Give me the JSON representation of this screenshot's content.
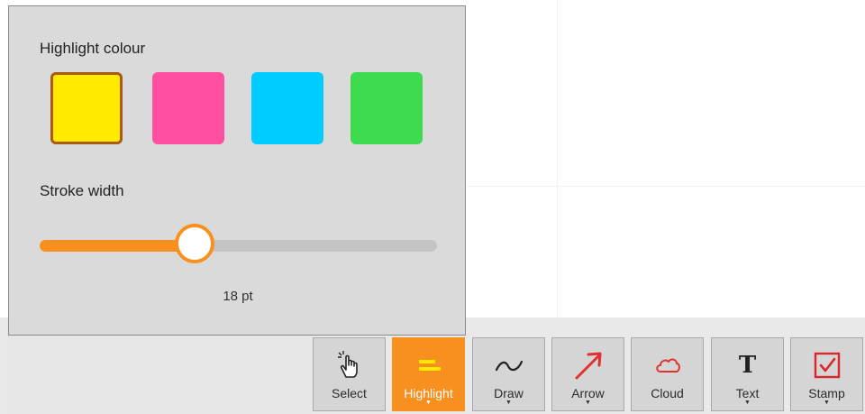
{
  "highlight_popup": {
    "colour_heading": "Highlight colour",
    "swatches": [
      {
        "name": "yellow",
        "color": "#ffea00",
        "selected": true
      },
      {
        "name": "pink",
        "color": "#ff4fa3",
        "selected": false
      },
      {
        "name": "cyan",
        "color": "#00ccff",
        "selected": false
      },
      {
        "name": "green",
        "color": "#3ddc50",
        "selected": false
      }
    ],
    "stroke_heading": "Stroke width",
    "stroke_fraction": 0.39,
    "stroke_value": "18 pt"
  },
  "toolbar": {
    "tools": [
      {
        "label": "Select",
        "icon": "hand-pointer-icon",
        "active": false,
        "has_menu": false
      },
      {
        "label": "Highlight",
        "icon": "highlighter-icon",
        "active": true,
        "has_menu": true
      },
      {
        "label": "Draw",
        "icon": "freehand-line-icon",
        "active": false,
        "has_menu": true
      },
      {
        "label": "Arrow",
        "icon": "arrow-icon",
        "active": false,
        "has_menu": true
      },
      {
        "label": "Cloud",
        "icon": "cloud-icon",
        "active": false,
        "has_menu": false
      },
      {
        "label": "Text",
        "icon": "text-icon",
        "active": false,
        "has_menu": true
      },
      {
        "label": "Stamp",
        "icon": "stamp-checkbox-icon",
        "active": false,
        "has_menu": true
      }
    ]
  },
  "colors": {
    "accent": "#f7901e",
    "arrow": "#e03131",
    "cloud": "#e03131",
    "stamp": "#d9262c"
  }
}
